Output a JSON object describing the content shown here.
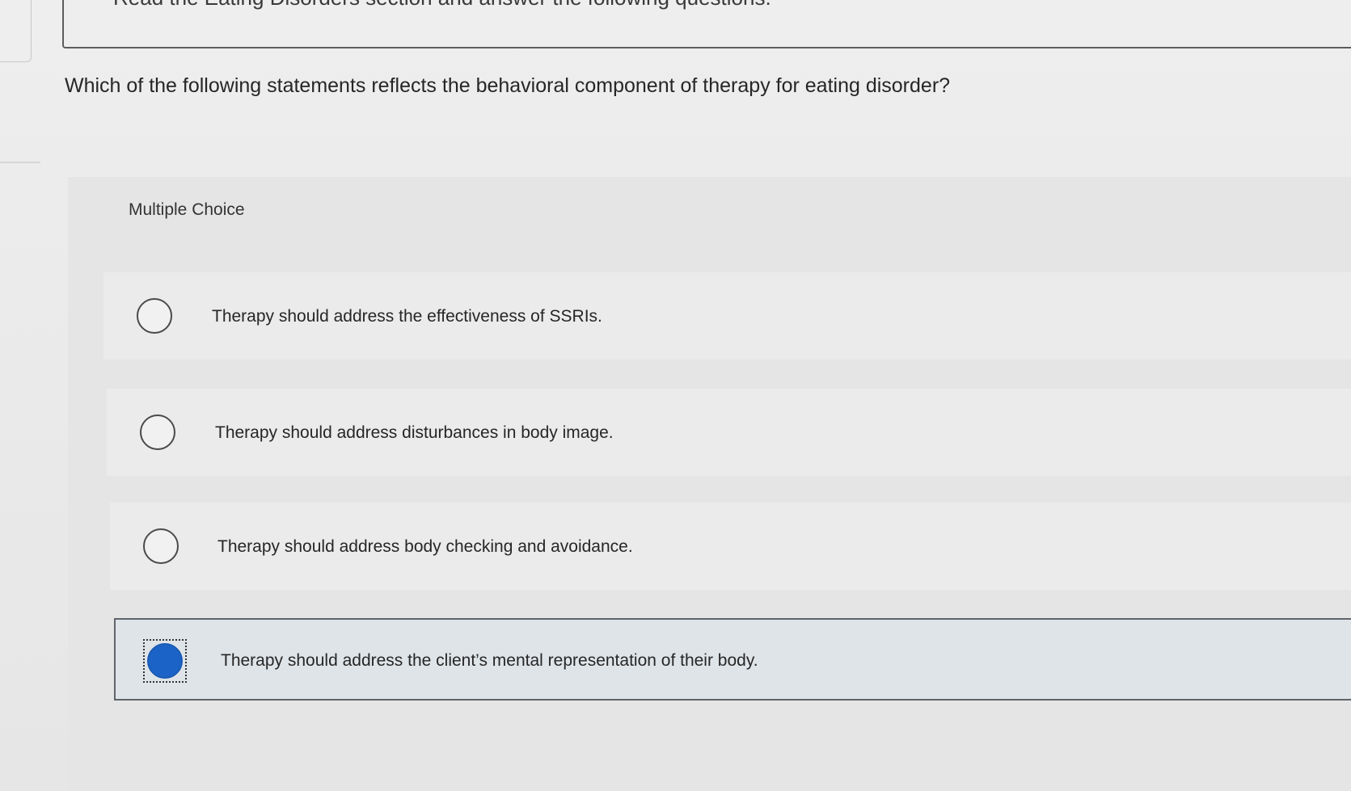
{
  "header": {
    "instructions": "Read the Eating Disorders section and answer the following questions."
  },
  "question": {
    "text": "Which of the following statements reflects the behavioral component of therapy for eating disorder?"
  },
  "multiple_choice": {
    "label": "Multiple Choice",
    "options": [
      {
        "label": "Therapy should address the effectiveness of SSRIs.",
        "selected": false
      },
      {
        "label": "Therapy should address disturbances in body image.",
        "selected": false
      },
      {
        "label": "Therapy should address body checking and avoidance.",
        "selected": false
      },
      {
        "label": "Therapy should address the client’s mental representation of their body.",
        "selected": true
      }
    ]
  },
  "colors": {
    "selected_radio": "#1b63c6",
    "selected_background": "#dfe4e8"
  }
}
